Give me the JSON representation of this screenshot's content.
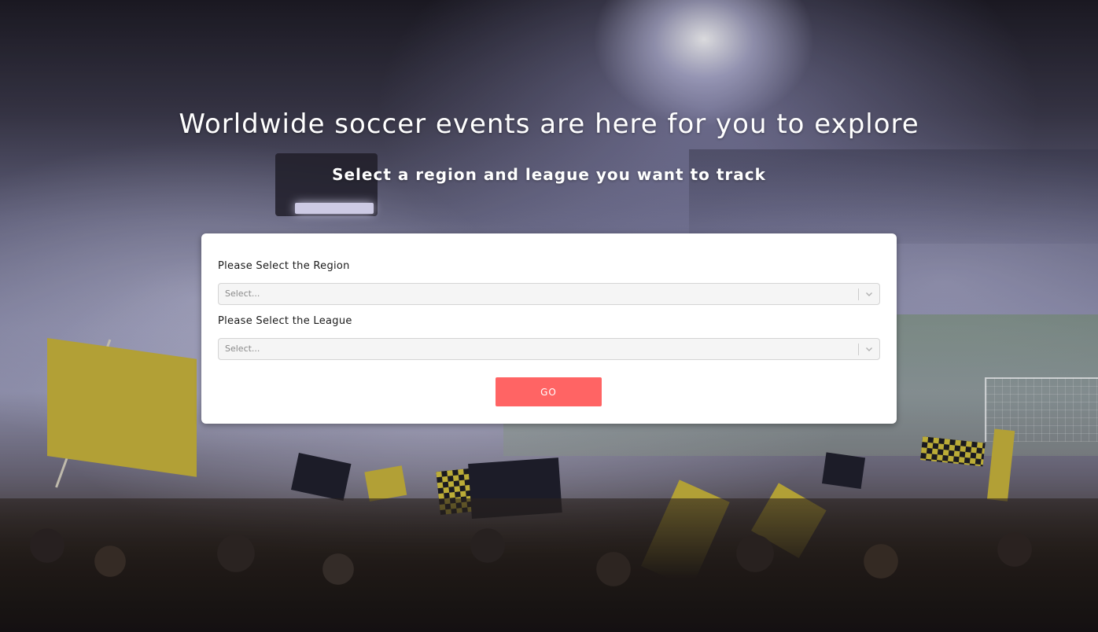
{
  "hero": {
    "title": "Worldwide soccer events are here for you to explore",
    "subtitle": "Select a region and league you want to track"
  },
  "form": {
    "region": {
      "label": "Please Select the Region",
      "placeholder": "Select..."
    },
    "league": {
      "label": "Please Select the League",
      "placeholder": "Select..."
    },
    "submit_label": "GO"
  },
  "colors": {
    "accent": "#ff6464",
    "card_background": "#ffffff",
    "select_background": "#f5f5f5"
  },
  "icons": {
    "select_indicator": "chevron-down-icon"
  }
}
